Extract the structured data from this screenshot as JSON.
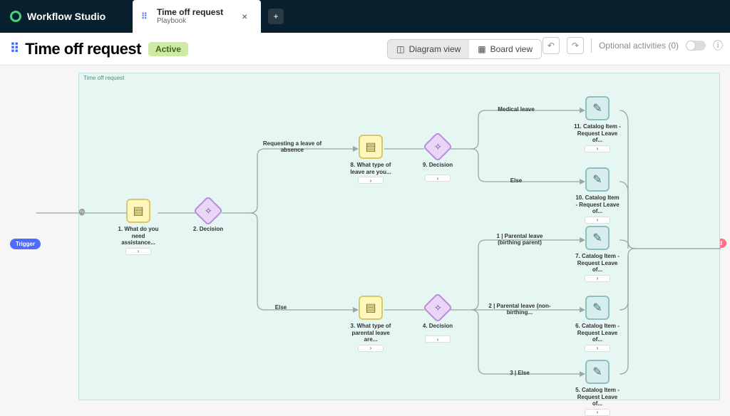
{
  "brand": "Workflow Studio",
  "tab": {
    "title": "Time off request",
    "subtitle": "Playbook"
  },
  "page": {
    "title": "Time off request",
    "status": "Active",
    "canvas_title": "Time off request"
  },
  "views": {
    "diagram": "Diagram view",
    "board": "Board view"
  },
  "tools": {
    "optional": "Optional activities (0)"
  },
  "trigger_label": "Trigger",
  "end_label": "End",
  "branches": {
    "requesting": "Requesting a leave of absence",
    "else_top": "Else",
    "medical": "Medical leave",
    "else_med": "Else",
    "p1": "1 | Parental leave (birthing parent)",
    "p2": "2 | Parental leave (non-birthing...",
    "p3": "3 | Else"
  },
  "nodes": {
    "n1": {
      "label": "1. What do you need assistance..."
    },
    "n2": {
      "label": "2. Decision"
    },
    "n3": {
      "label": "3. What type of parental leave are..."
    },
    "n4": {
      "label": "4. Decision"
    },
    "n5": {
      "label": "5. Catalog Item - Request Leave of..."
    },
    "n6": {
      "label": "6. Catalog Item - Request Leave of..."
    },
    "n7": {
      "label": "7. Catalog Item - Request Leave of..."
    },
    "n8": {
      "label": "8. What type of leave are you..."
    },
    "n9": {
      "label": "9. Decision"
    },
    "n10": {
      "label": "10. Catalog Item - Request Leave of..."
    },
    "n11": {
      "label": "11. Catalog Item - Request Leave of..."
    }
  }
}
